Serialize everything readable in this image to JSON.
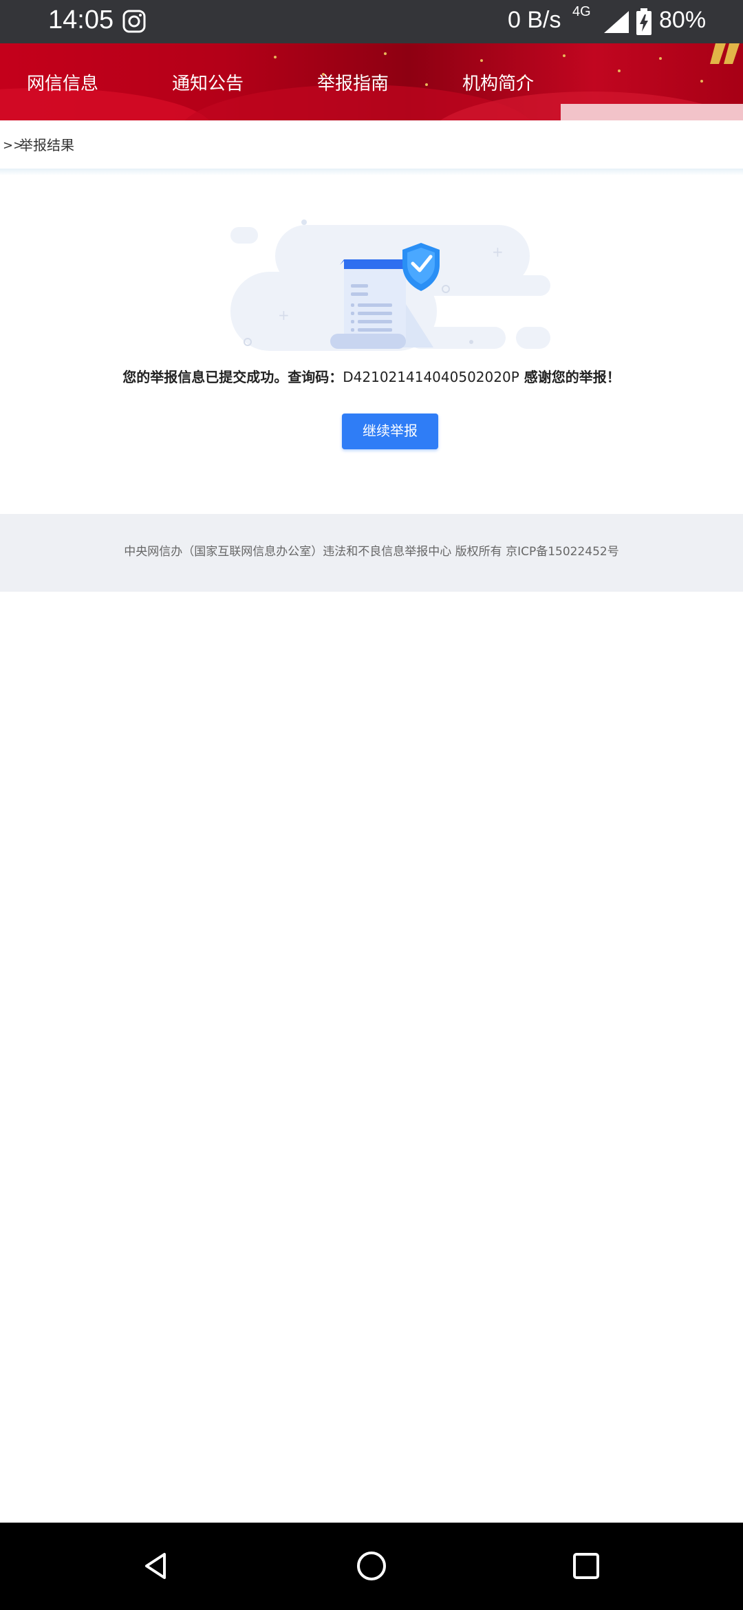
{
  "status_bar": {
    "time": "14:05",
    "net_speed": "0 B/s",
    "network_type": "4G",
    "battery": "80%"
  },
  "header_nav": {
    "items": [
      {
        "label": "网信信息"
      },
      {
        "label": "通知公告"
      },
      {
        "label": "举报指南"
      },
      {
        "label": "机构简介"
      }
    ]
  },
  "breadcrumb": {
    "arrow": ">>",
    "label": "举报结果"
  },
  "result": {
    "message_prefix": "您的举报信息已提交成功。查询码：",
    "query_code": "D421021414040502020P",
    "message_suffix": "感谢您的举报！",
    "continue_button": "继续举报"
  },
  "footer": {
    "text": "中央网信办（国家互联网信息办公室）违法和不良信息举报中心 版权所有 京ICP备15022452号"
  },
  "colors": {
    "header_red": "#c4001b",
    "button_blue": "#2f7df6",
    "status_bar": "#343539",
    "footer_bg": "#eef0f4"
  },
  "icons": [
    "instagram-icon",
    "signal-icon",
    "battery-icon",
    "back-icon",
    "home-icon",
    "recents-icon",
    "shield-check-icon"
  ]
}
